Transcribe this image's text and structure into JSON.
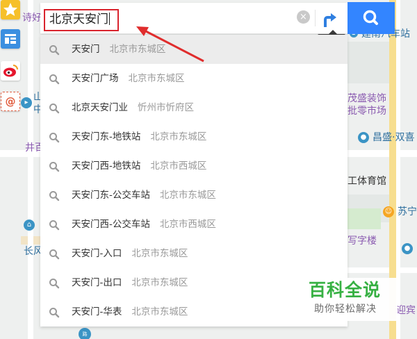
{
  "search": {
    "query": "北京天安门",
    "clear_glyph": "×",
    "route_tooltip": "路线"
  },
  "suggestions": [
    {
      "name": "天安门",
      "region": "北京市东城区"
    },
    {
      "name": "天安门广场",
      "region": "北京市东城区"
    },
    {
      "name": "北京天安门业",
      "region": "忻州市忻府区"
    },
    {
      "name": "天安门东-地铁站",
      "region": "北京市东城区"
    },
    {
      "name": "天安门西-地铁站",
      "region": "北京市西城区"
    },
    {
      "name": "天安门东-公交车站",
      "region": "北京市东城区"
    },
    {
      "name": "天安门西-公交车站",
      "region": "北京市西城区"
    },
    {
      "name": "天安门-入口",
      "region": "北京市东城区"
    },
    {
      "name": "天安门-出口",
      "region": "北京市东城区"
    },
    {
      "name": "天安门-华表",
      "region": "北京市东城区"
    }
  ],
  "map_labels": {
    "top_left": "诗好",
    "shanxi_l1": "山",
    "shanxi_l2": "中",
    "well": "井百",
    "changfeng": "长风",
    "jiannan_bus": "建南汽车站",
    "decor_l1": "茂盛装饰",
    "decor_l2": "批零市场",
    "changsheng": "昌盛·双喜",
    "stadium": "工体育馆",
    "suning": "苏宁",
    "office": "写字楼",
    "guest": "迎宾",
    "bottom_poi": "路"
  },
  "rail": {
    "star_icon": "star-icon",
    "layout_icon": "layout-icon",
    "weibo_icon": "weibo-icon",
    "mail_icon": "at-icon",
    "mail_glyph": "@"
  },
  "watermark": {
    "title": "百科全说",
    "subtitle": "助你轻松解决"
  },
  "colors": {
    "search_button": "#3385ff",
    "highlight_border": "#d9232d",
    "annotation_arrow": "#e02d2d",
    "watermark_green": "#2fae3c",
    "active_row": "#ececec"
  }
}
